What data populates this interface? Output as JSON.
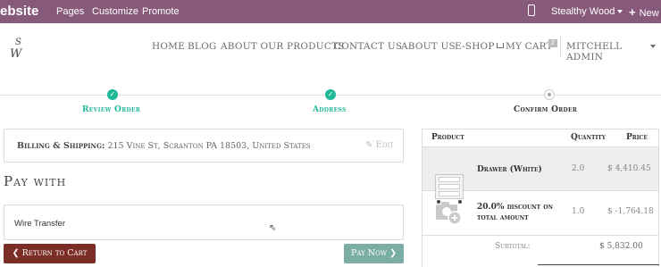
{
  "topbar": {
    "brand": "ebsite",
    "menu": [
      "Pages",
      "Customize",
      "Promote"
    ],
    "user": "Stealthy Wood",
    "new_label": "New"
  },
  "site": {
    "logo_text": "SW",
    "nav": [
      "HOME",
      "BLOG",
      "ABOUT OUR PRODUCTS",
      "CONTACT US",
      "ABOUT US",
      "E-SHOP",
      "MY CART",
      "MITCHELL ADMIN"
    ],
    "cart_count": "2"
  },
  "wizard": {
    "steps": [
      {
        "label": "Review Order",
        "state": "done"
      },
      {
        "label": "Address",
        "state": "done"
      },
      {
        "label": "Confirm Order",
        "state": "current"
      }
    ]
  },
  "checkout": {
    "billing_label": "Billing & Shipping:",
    "billing_address": "215 Vine St, Scranton PA 18503, United States",
    "edit_label": "Edit",
    "pay_with": "Pay with",
    "payment_method": "Wire Transfer",
    "return_label": "Return to Cart",
    "pay_label": "Pay Now"
  },
  "summary": {
    "headers": [
      "Product",
      "Quantity",
      "Price"
    ],
    "rows": [
      {
        "name": "Drawer (White)",
        "qty": "2.0",
        "price": "$ 4,410.45"
      },
      {
        "name_line1": "20.0% discount on",
        "name_line2": "total amount",
        "qty": "1.0",
        "price": "$ -1,764.18"
      }
    ],
    "subtotal_label": "Subtotal:",
    "subtotal_value": "$ 5,832.00"
  },
  "colors": {
    "topbar": "#875a7b",
    "success": "#21b799",
    "return_btn": "#7b2d26",
    "pay_btn": "#7aaea5"
  }
}
